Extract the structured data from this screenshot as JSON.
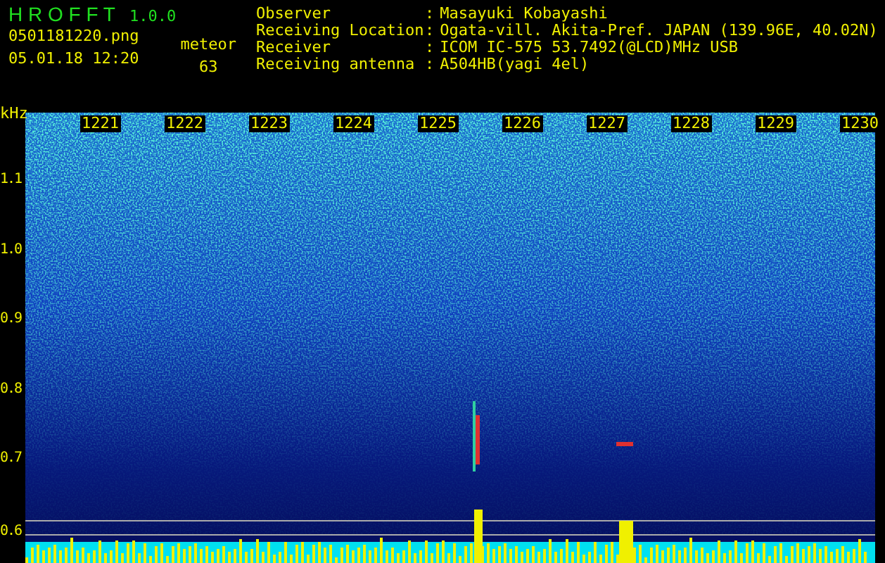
{
  "app": {
    "title": "H R O F F T",
    "version": "1.0.0"
  },
  "file": "0501181220.png",
  "datetime": "05.01.18 12:20",
  "meteor": {
    "label": "meteor",
    "count": "63"
  },
  "info": [
    {
      "label": "Observer",
      "separator": ":",
      "value": "Masayuki Kobayashi"
    },
    {
      "label": "Receiving Location",
      "separator": ":",
      "value": "Ogata-vill. Akita-Pref. JAPAN (139.96E, 40.02N)"
    },
    {
      "label": "Receiver",
      "separator": ":",
      "value": "ICOM IC-575 53.7492(@LCD)MHz USB"
    },
    {
      "label": "Receiving antenna",
      "separator": ":",
      "value": "A504HB(yagi 4el)"
    }
  ],
  "plot": {
    "y_unit": "kHz",
    "y_labels": [
      "1.1",
      "1.0",
      "0.9",
      "0.8",
      "0.7",
      "0.6"
    ],
    "time_labels": [
      "1221",
      "1222",
      "1223",
      "1224",
      "1225",
      "1226",
      "1227",
      "1228",
      "1229",
      "1230"
    ]
  }
}
